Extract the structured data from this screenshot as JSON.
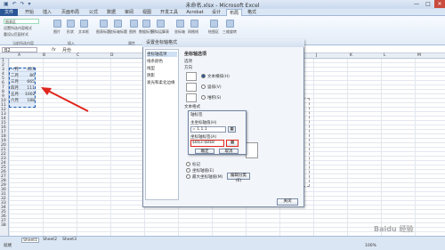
{
  "window": {
    "title": "未命名.xlsx - Microsoft Excel",
    "qat": "▣ ↶ ↷ ▾",
    "minimize": "—",
    "restore": "□",
    "close": "✕"
  },
  "tabs": [
    "文件",
    "开始",
    "插入",
    "页面布局",
    "公式",
    "数据",
    "审阅",
    "视图",
    "开发工具",
    "Acrobat",
    "设计",
    "布局",
    "格式"
  ],
  "ribbon": {
    "left_buttons": [
      "图表区",
      "设置所选内容格式",
      "重设以匹配样式"
    ],
    "groups": [
      "当前所选内容",
      "插入",
      "属性",
      "坐标轴"
    ],
    "buttons": [
      "图片",
      "形状",
      "文本框",
      "图表标题",
      "坐标轴标题",
      "图例",
      "数据标签",
      "模拟运算表",
      "坐标轴",
      "网格线",
      "绘图区",
      "三维旋转"
    ]
  },
  "formula_bar": {
    "name_box": "B2",
    "fx": "fx",
    "value": "月份"
  },
  "sheet": {
    "rows": [
      "1",
      "2",
      "3",
      "4",
      "5",
      "6",
      "7",
      "8",
      "9",
      "10",
      "11",
      "12",
      "13",
      "14",
      "15",
      "16",
      "17",
      "18",
      "19",
      "20",
      "21",
      "22",
      "23",
      "24",
      "25",
      "26",
      "27",
      "28",
      "29",
      "30",
      "31",
      "32",
      "33",
      "34",
      "35",
      "36",
      "37",
      "38"
    ],
    "columns": [
      "A",
      "B",
      "C",
      "D",
      "E",
      "F",
      "G",
      "H",
      "I",
      "J",
      "K",
      "L",
      "M"
    ],
    "data": [
      {
        "month": "一月",
        "value": "423"
      },
      {
        "month": "二月",
        "value": "86"
      },
      {
        "month": "三月",
        "value": "665"
      },
      {
        "month": "四月",
        "value": "111"
      },
      {
        "month": "五月",
        "value": "1002"
      },
      {
        "month": "六月",
        "value": "188"
      }
    ]
  },
  "dialog": {
    "title": "设置坐标轴格式",
    "nav": [
      "坐标轴选项",
      "线条颜色",
      "线型",
      "阴影",
      "发光和柔化边缘"
    ],
    "section_title": "坐标轴选项",
    "option_label": "选项",
    "direction_label": "方向",
    "radio_options": [
      "文本横排(H)",
      "竖排(V)",
      "堆积(S)"
    ],
    "text_layout_label": "文本格式",
    "other_radios": [
      "标记",
      "坐标轴值(E)",
      "最大坐标轴值(M)"
    ],
    "edit_button": "编辑分类(E)",
    "close_button": "关闭"
  },
  "inner_dialog": {
    "title": "轴标签",
    "label1": "主坐标轴值(H)",
    "value1": "= 1.1.1",
    "label2": "坐标轴标签(A)",
    "value2": "$B$3:$B$8",
    "ok": "确定",
    "cancel": "取消"
  },
  "sheets": [
    "Sheet1",
    "Sheet2",
    "Sheet3"
  ],
  "status": {
    "ready": "就绪",
    "zoom": "100%"
  },
  "watermark": "Baidu 经验"
}
